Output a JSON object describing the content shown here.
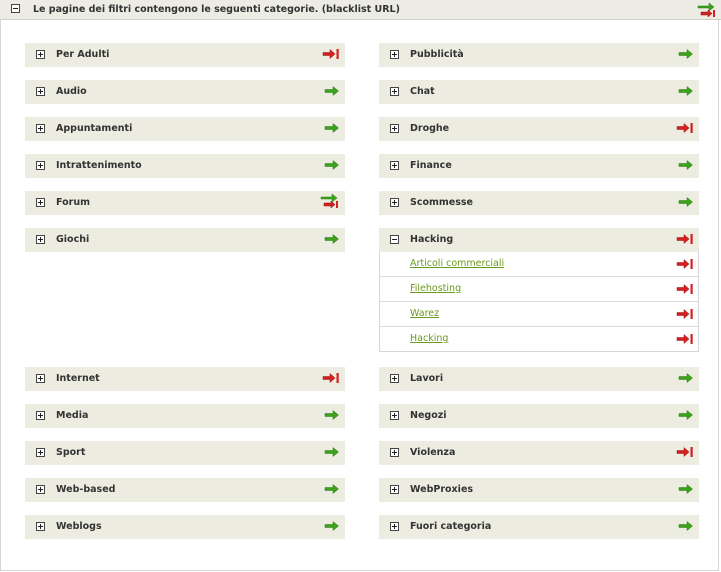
{
  "header": {
    "title": "Le pagine dei filtri contengono le seguenti categorie. (blacklist URL)",
    "icon": "allow-block-icon"
  },
  "colors": {
    "allow": "#3aa31b",
    "block": "#d42020",
    "link": "#6a9a1f",
    "row_bg": "#ecece0"
  },
  "left_column": [
    {
      "label": "Per Adulti",
      "status": "block"
    },
    {
      "label": "Audio",
      "status": "allow"
    },
    {
      "label": "Appuntamenti",
      "status": "allow"
    },
    {
      "label": "Intrattenimento",
      "status": "allow"
    },
    {
      "label": "Forum",
      "status": "mixed"
    },
    {
      "label": "Giochi",
      "status": "allow"
    },
    {
      "label": "Internet",
      "status": "block"
    },
    {
      "label": "Media",
      "status": "allow"
    },
    {
      "label": "Sport",
      "status": "allow"
    },
    {
      "label": "Web-based",
      "status": "allow"
    },
    {
      "label": "Weblogs",
      "status": "allow"
    }
  ],
  "right_column": [
    {
      "label": "Pubblicità",
      "status": "allow"
    },
    {
      "label": "Chat",
      "status": "allow"
    },
    {
      "label": "Droghe",
      "status": "block"
    },
    {
      "label": "Finance",
      "status": "allow"
    },
    {
      "label": "Scommesse",
      "status": "allow"
    },
    {
      "label": "Hacking",
      "status": "block",
      "expanded": true
    },
    {
      "label": "Lavori",
      "status": "allow"
    },
    {
      "label": "Negozi",
      "status": "allow"
    },
    {
      "label": "Violenza",
      "status": "block"
    },
    {
      "label": "WebProxies",
      "status": "allow"
    },
    {
      "label": "Fuori categoria",
      "status": "allow"
    }
  ],
  "hacking_subcategories": [
    {
      "label": "Articoli commerciali",
      "status": "block"
    },
    {
      "label": "Filehosting",
      "status": "block"
    },
    {
      "label": "Warez",
      "status": "block"
    },
    {
      "label": "Hacking",
      "status": "block"
    }
  ]
}
